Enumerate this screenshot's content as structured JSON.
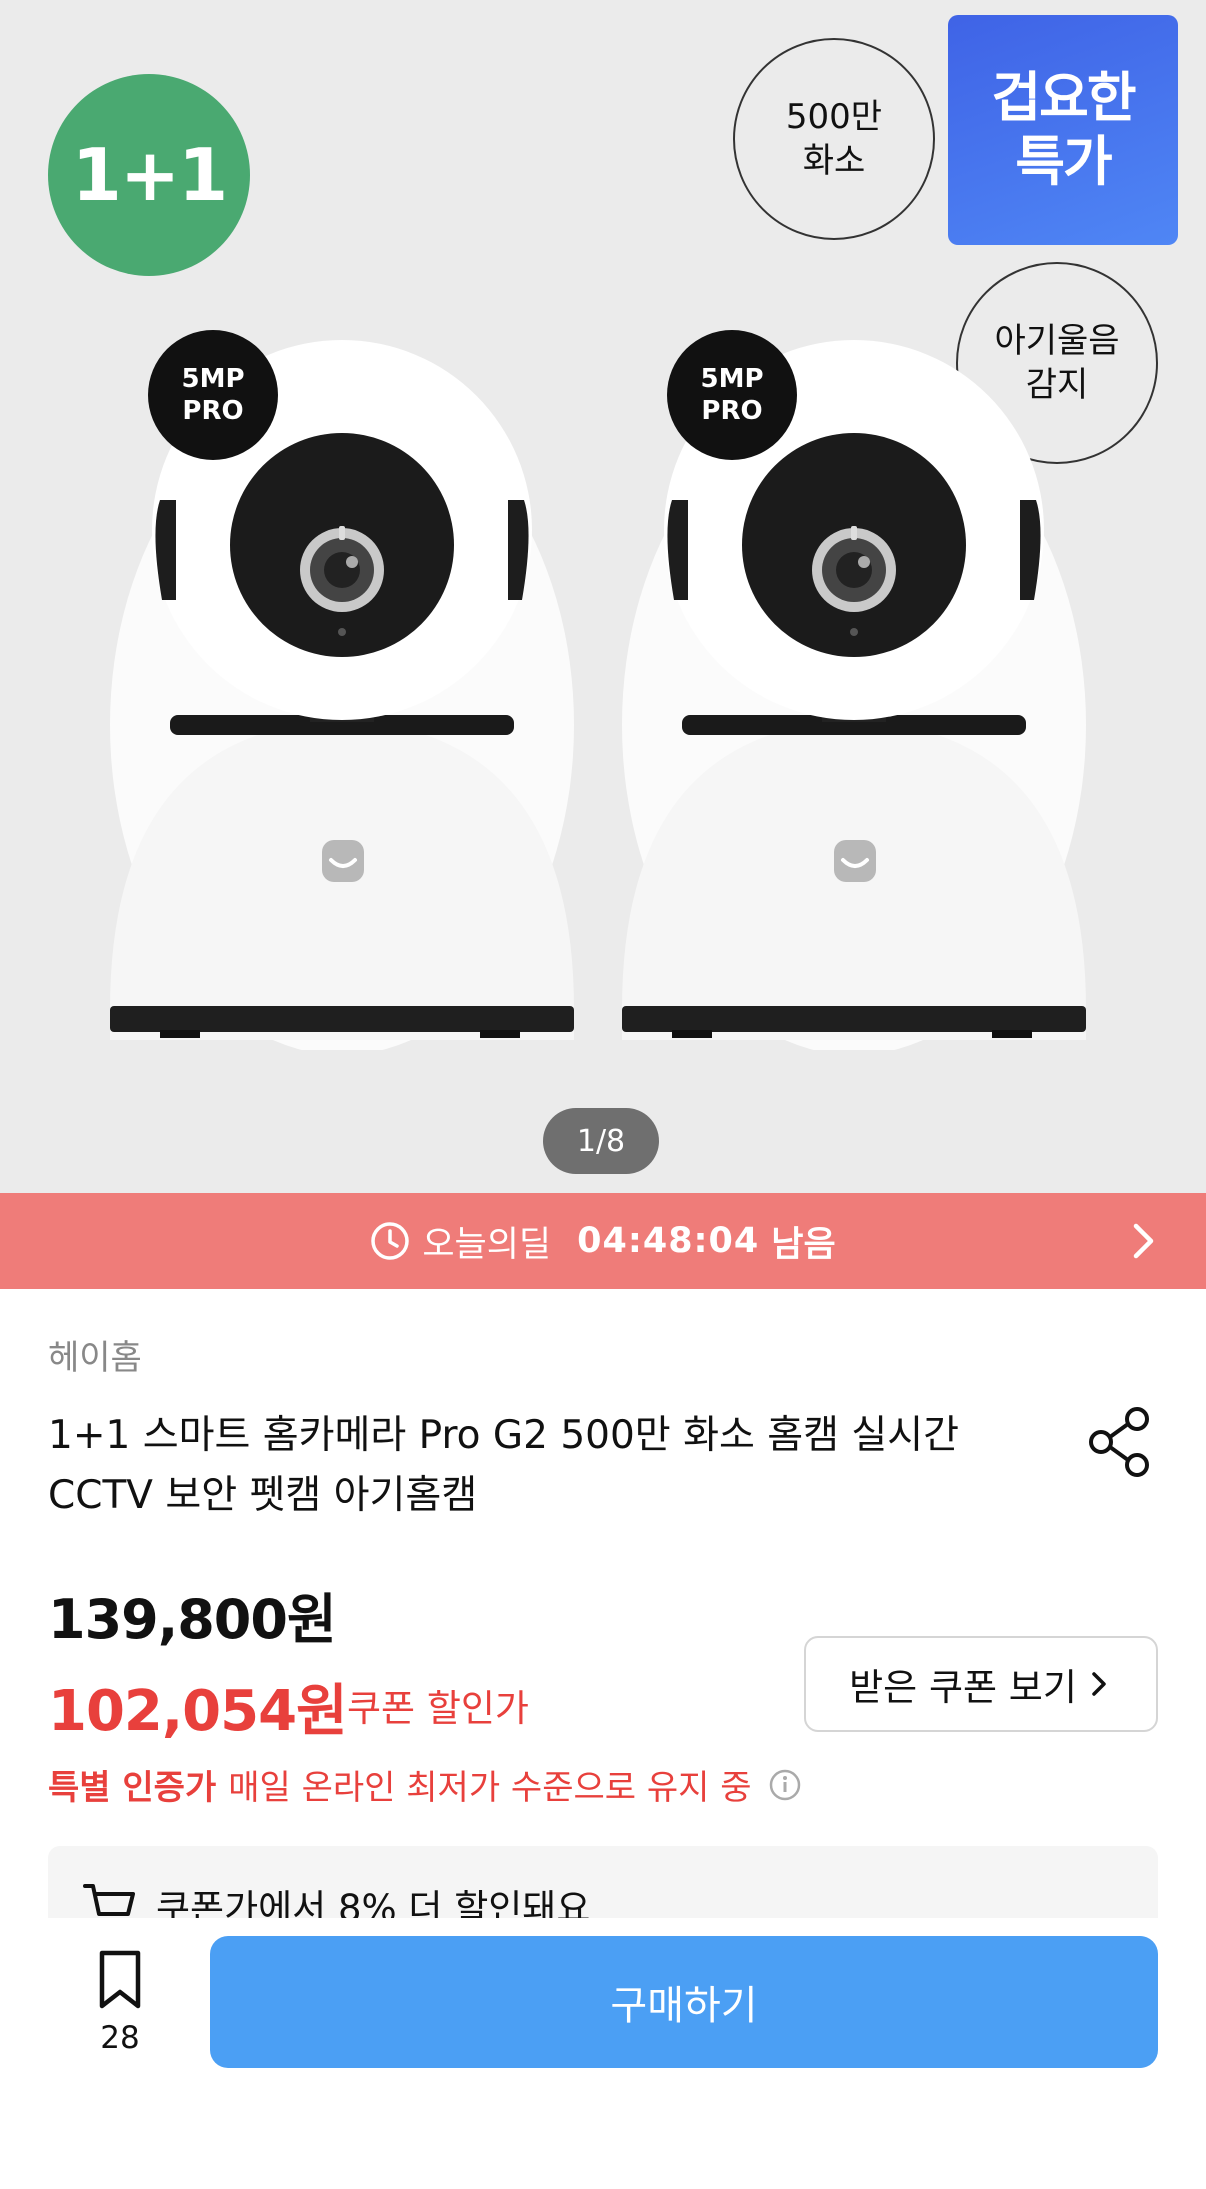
{
  "hero": {
    "badge_1p1": "1+1",
    "badge_resolution": [
      "500만",
      "화소"
    ],
    "badge_baby": [
      "아기울음",
      "감지"
    ],
    "deal_box": [
      "겁요한",
      "특가"
    ],
    "mp_badge": [
      "5MP",
      "PRO"
    ],
    "pager": "1/8"
  },
  "deal_bar": {
    "label": "오늘의딜",
    "time": "04:48:04",
    "remain": "남음",
    "icon": "clock-icon",
    "color": "#ef7c79"
  },
  "product": {
    "seller": "헤이홈",
    "title": "1+1 스마트 홈카메라 Pro G2 500만 화소 홈캠 실시간 CCTV 보안 펫캠 아기홈캠",
    "original_price": "139,800원",
    "sale_price": "102,054원",
    "sale_label": "쿠폰 할인가",
    "coupon_button": "받은 쿠폰 보기",
    "cert_strong": "특별 인증가",
    "cert_text": "매일 온라인 최저가 수준으로 유지 중",
    "coupon_notice": "쿠폰가에서 8% 더 할인돼요",
    "accent_color": "#e8403c"
  },
  "bottom": {
    "bookmark_count": "28",
    "buy_label": "구매하기",
    "buy_color": "#4b9ff4"
  }
}
